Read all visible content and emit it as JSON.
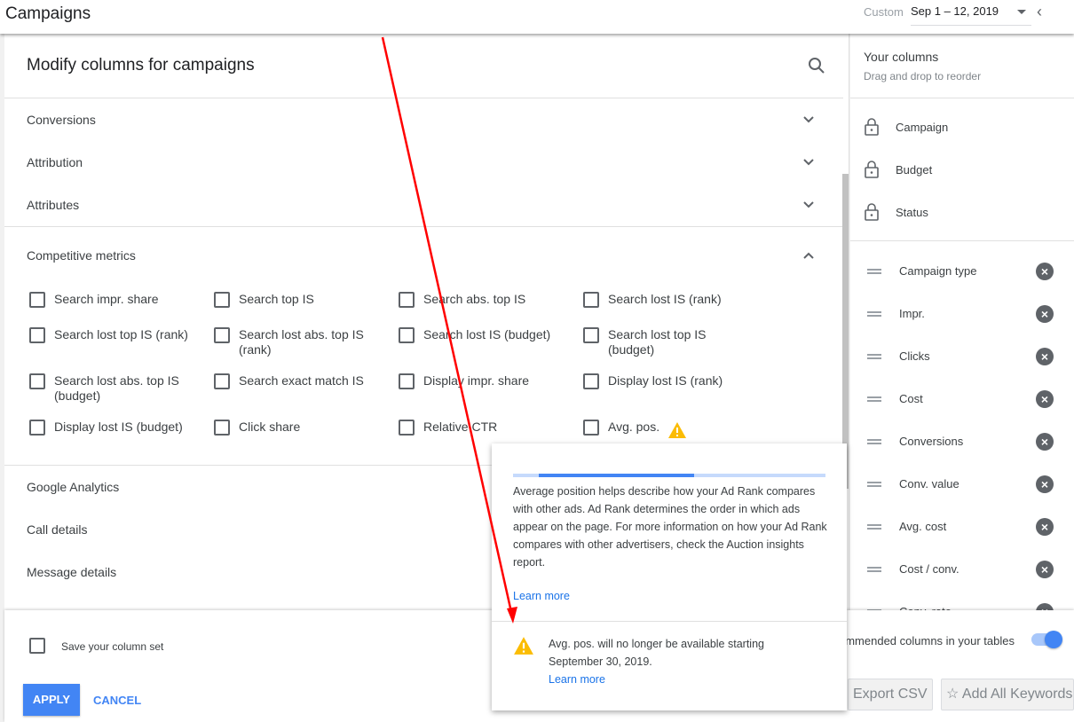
{
  "topbar": {
    "title": "Campaigns",
    "date_label": "Custom",
    "date_range": "Sep 1 – 12, 2019"
  },
  "modify": {
    "title": "Modify columns for campaigns",
    "sections": [
      "Conversions",
      "Attribution",
      "Attributes"
    ],
    "expanded": "Competitive metrics",
    "metrics": [
      "Search impr. share",
      "Search top IS",
      "Search abs. top IS",
      "Search lost IS (rank)",
      "Search lost top IS (rank)",
      "Search lost abs. top IS (rank)",
      "Search lost IS (budget)",
      "Search lost top IS (budget)",
      "Search lost abs. top IS (budget)",
      "Search exact match IS",
      "Display impr. share",
      "Display lost IS (rank)",
      "Display lost IS (budget)",
      "Click share",
      "Relative CTR",
      "Avg. pos."
    ],
    "more_sections": [
      "Google Analytics",
      "Call details",
      "Message details"
    ]
  },
  "your_columns": {
    "title": "Your columns",
    "subtitle": "Drag and drop to reorder",
    "locked": [
      "Campaign",
      "Budget",
      "Status"
    ],
    "removable": [
      "Campaign type",
      "Impr.",
      "Clicks",
      "Cost",
      "Conversions",
      "Conv. value",
      "Avg. cost",
      "Cost / conv.",
      "Conv. rate"
    ]
  },
  "footer": {
    "save_label": "Save your column set",
    "apply": "APPLY",
    "cancel": "CANCEL",
    "recommended": "ommended columns in your tables",
    "recommended_on": true,
    "export": "Export CSV",
    "add_keywords": "Add All Keywords"
  },
  "tooltip": {
    "progress": 0.58,
    "body": "Average position helps describe how your Ad Rank compares with other ads. Ad Rank determines the order in which ads appear on the page. For more information on how your Ad Rank compares with other advertisers, check the Auction insights report.",
    "learn_more": "Learn more",
    "warning": "Avg. pos. will no longer be available starting September 30, 2019.",
    "warning_link": "Learn more"
  },
  "colors": {
    "accent": "#4285f4",
    "warning": "#fbbc04",
    "annotation": "#ff0000"
  }
}
